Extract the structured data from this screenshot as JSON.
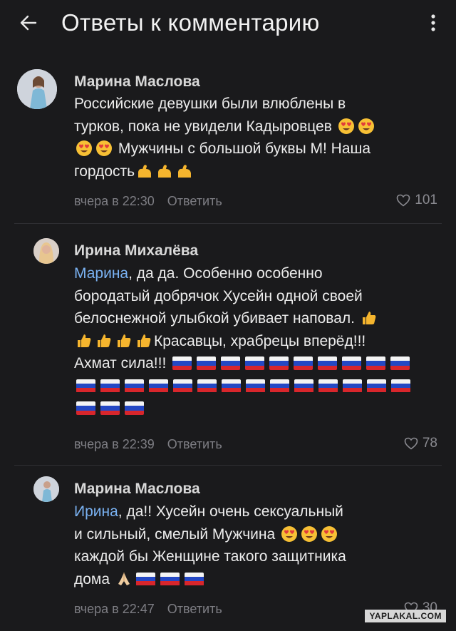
{
  "header": {
    "title": "Ответы к комментарию",
    "back_icon": "arrow-left-icon",
    "more_icon": "more-vertical-icon"
  },
  "comments": [
    {
      "author": "Марина Маслова",
      "lines": [
        "Российские девушки были влюблены в",
        "турков, пока не увидели Кадыровцев",
        "Мужчины с большой буквы М! Наша",
        "гордость"
      ],
      "time": "вчера в 22:30",
      "reply_label": "Ответить",
      "likes": "101"
    },
    {
      "author": "Ирина Михалёва",
      "mention": "Марина",
      "lines": [
        ", да да. Особенно особенно",
        "бородатый добрячок Хусейн одной своей",
        "белоснежной улыбкой убивает наповал.",
        "Красавцы, храбрецы вперёд!!!",
        "Ахмат сила!!!"
      ],
      "time": "вчера в 22:39",
      "reply_label": "Ответить",
      "likes": "78"
    },
    {
      "author": "Марина Маслова",
      "mention": "Ирина",
      "lines": [
        ", да!! Хусейн очень сексуальный",
        "и сильный, смелый Мужчина",
        "каждой бы Женщине такого защитника",
        "дома"
      ],
      "time": "вчера в 22:47",
      "reply_label": "Ответить",
      "likes": "30"
    }
  ],
  "watermark": "YAPLAKAL.COM",
  "colors": {
    "background": "#1a1a1c",
    "mention": "#7ab2f2",
    "meta": "#7e7e84"
  }
}
